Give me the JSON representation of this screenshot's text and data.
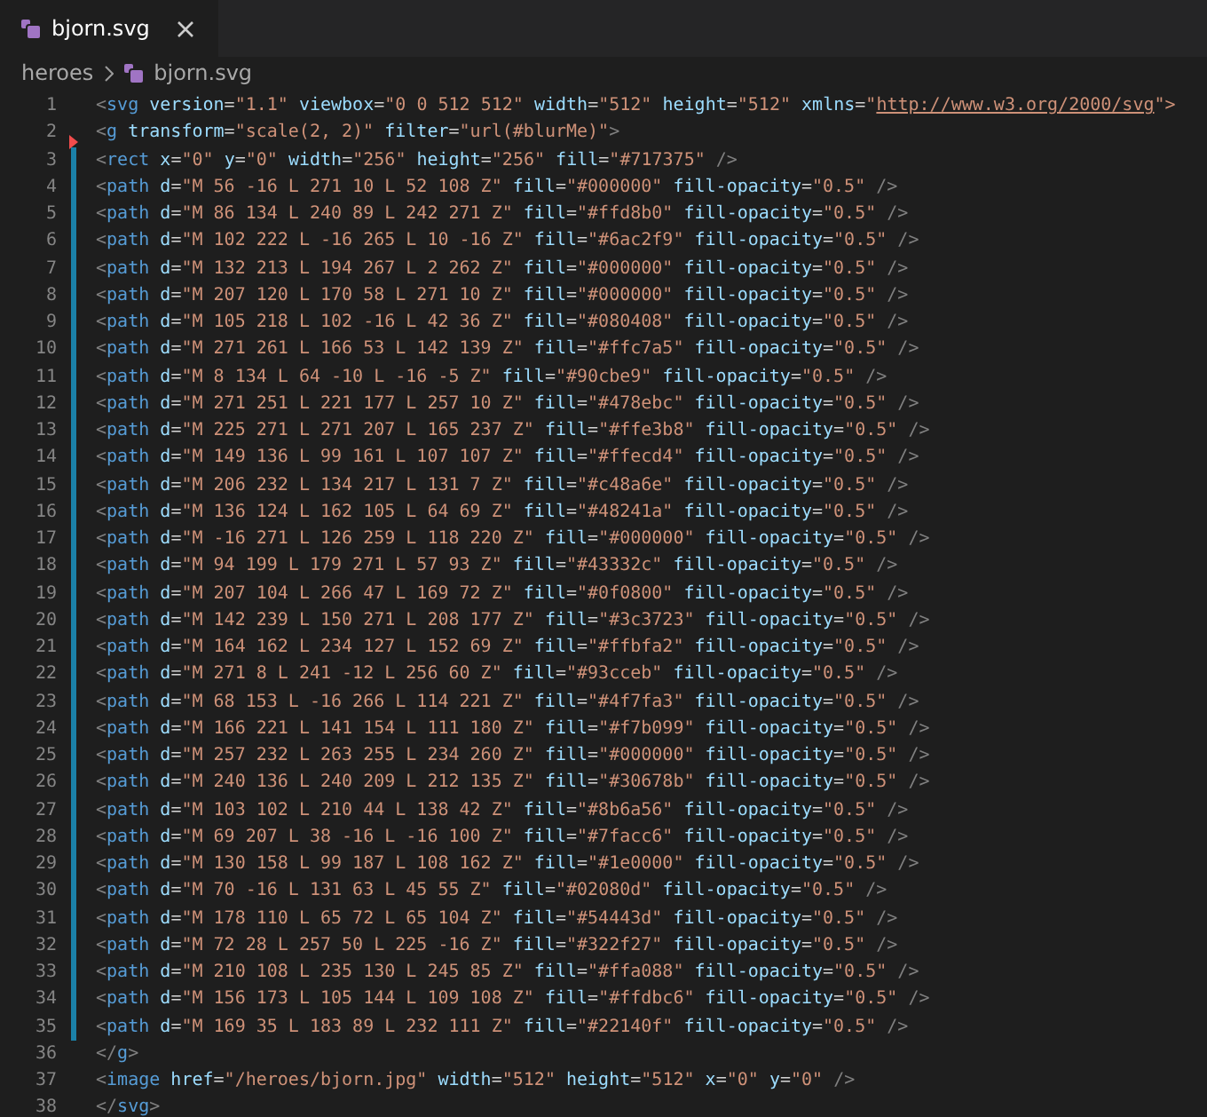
{
  "tab": {
    "title": "bjorn.svg",
    "selected": true
  },
  "breadcrumb": [
    {
      "label": "heroes",
      "kind": "folder"
    },
    {
      "label": "bjorn.svg",
      "kind": "file"
    }
  ],
  "lines": [
    {
      "number": "1",
      "modified": false,
      "deleted": false,
      "segments": [
        {
          "kind": "code",
          "text": "<svg version=\"1.1\" viewbox=\"0 0 512 512\" width=\"512\" height=\"512\" xmlns=\""
        },
        {
          "kind": "link",
          "text": "http://www.w3.org/2000/svg"
        },
        {
          "kind": "code",
          "text": "\">"
        }
      ]
    },
    {
      "number": "2",
      "modified": false,
      "deleted": true,
      "text": "<g transform=\"scale(2, 2)\" filter=\"url(#blurMe)\">"
    },
    {
      "number": "3",
      "modified": true,
      "deleted": false,
      "text": "<rect x=\"0\" y=\"0\" width=\"256\" height=\"256\" fill=\"#717375\" />"
    },
    {
      "number": "4",
      "modified": true,
      "deleted": false,
      "text": "<path d=\"M 56 -16 L 271 10 L 52 108 Z\" fill=\"#000000\" fill-opacity=\"0.5\" />"
    },
    {
      "number": "5",
      "modified": true,
      "deleted": false,
      "text": "<path d=\"M 86 134 L 240 89 L 242 271 Z\" fill=\"#ffd8b0\" fill-opacity=\"0.5\" />"
    },
    {
      "number": "6",
      "modified": true,
      "deleted": false,
      "text": "<path d=\"M 102 222 L -16 265 L 10 -16 Z\" fill=\"#6ac2f9\" fill-opacity=\"0.5\" />"
    },
    {
      "number": "7",
      "modified": true,
      "deleted": false,
      "text": "<path d=\"M 132 213 L 194 267 L 2 262 Z\" fill=\"#000000\" fill-opacity=\"0.5\" />"
    },
    {
      "number": "8",
      "modified": true,
      "deleted": false,
      "text": "<path d=\"M 207 120 L 170 58 L 271 10 Z\" fill=\"#000000\" fill-opacity=\"0.5\" />"
    },
    {
      "number": "9",
      "modified": true,
      "deleted": false,
      "text": "<path d=\"M 105 218 L 102 -16 L 42 36 Z\" fill=\"#080408\" fill-opacity=\"0.5\" />"
    },
    {
      "number": "10",
      "modified": true,
      "deleted": false,
      "text": "<path d=\"M 271 261 L 166 53 L 142 139 Z\" fill=\"#ffc7a5\" fill-opacity=\"0.5\" />"
    },
    {
      "number": "11",
      "modified": true,
      "deleted": false,
      "text": "<path d=\"M 8 134 L 64 -10 L -16 -5 Z\" fill=\"#90cbe9\" fill-opacity=\"0.5\" />"
    },
    {
      "number": "12",
      "modified": true,
      "deleted": false,
      "text": "<path d=\"M 271 251 L 221 177 L 257 10 Z\" fill=\"#478ebc\" fill-opacity=\"0.5\" />"
    },
    {
      "number": "13",
      "modified": true,
      "deleted": false,
      "text": "<path d=\"M 225 271 L 271 207 L 165 237 Z\" fill=\"#ffe3b8\" fill-opacity=\"0.5\" />"
    },
    {
      "number": "14",
      "modified": true,
      "deleted": false,
      "text": "<path d=\"M 149 136 L 99 161 L 107 107 Z\" fill=\"#ffecd4\" fill-opacity=\"0.5\" />"
    },
    {
      "number": "15",
      "modified": true,
      "deleted": false,
      "text": "<path d=\"M 206 232 L 134 217 L 131 7 Z\" fill=\"#c48a6e\" fill-opacity=\"0.5\" />"
    },
    {
      "number": "16",
      "modified": true,
      "deleted": false,
      "text": "<path d=\"M 136 124 L 162 105 L 64 69 Z\" fill=\"#48241a\" fill-opacity=\"0.5\" />"
    },
    {
      "number": "17",
      "modified": true,
      "deleted": false,
      "text": "<path d=\"M -16 271 L 126 259 L 118 220 Z\" fill=\"#000000\" fill-opacity=\"0.5\" />"
    },
    {
      "number": "18",
      "modified": true,
      "deleted": false,
      "text": "<path d=\"M 94 199 L 179 271 L 57 93 Z\" fill=\"#43332c\" fill-opacity=\"0.5\" />"
    },
    {
      "number": "19",
      "modified": true,
      "deleted": false,
      "text": "<path d=\"M 207 104 L 266 47 L 169 72 Z\" fill=\"#0f0800\" fill-opacity=\"0.5\" />"
    },
    {
      "number": "20",
      "modified": true,
      "deleted": false,
      "text": "<path d=\"M 142 239 L 150 271 L 208 177 Z\" fill=\"#3c3723\" fill-opacity=\"0.5\" />"
    },
    {
      "number": "21",
      "modified": true,
      "deleted": false,
      "text": "<path d=\"M 164 162 L 234 127 L 152 69 Z\" fill=\"#ffbfa2\" fill-opacity=\"0.5\" />"
    },
    {
      "number": "22",
      "modified": true,
      "deleted": false,
      "text": "<path d=\"M 271 8 L 241 -12 L 256 60 Z\" fill=\"#93cceb\" fill-opacity=\"0.5\" />"
    },
    {
      "number": "23",
      "modified": true,
      "deleted": false,
      "text": "<path d=\"M 68 153 L -16 266 L 114 221 Z\" fill=\"#4f7fa3\" fill-opacity=\"0.5\" />"
    },
    {
      "number": "24",
      "modified": true,
      "deleted": false,
      "text": "<path d=\"M 166 221 L 141 154 L 111 180 Z\" fill=\"#f7b099\" fill-opacity=\"0.5\" />"
    },
    {
      "number": "25",
      "modified": true,
      "deleted": false,
      "text": "<path d=\"M 257 232 L 263 255 L 234 260 Z\" fill=\"#000000\" fill-opacity=\"0.5\" />"
    },
    {
      "number": "26",
      "modified": true,
      "deleted": false,
      "text": "<path d=\"M 240 136 L 240 209 L 212 135 Z\" fill=\"#30678b\" fill-opacity=\"0.5\" />"
    },
    {
      "number": "27",
      "modified": true,
      "deleted": false,
      "text": "<path d=\"M 103 102 L 210 44 L 138 42 Z\" fill=\"#8b6a56\" fill-opacity=\"0.5\" />"
    },
    {
      "number": "28",
      "modified": true,
      "deleted": false,
      "text": "<path d=\"M 69 207 L 38 -16 L -16 100 Z\" fill=\"#7facc6\" fill-opacity=\"0.5\" />"
    },
    {
      "number": "29",
      "modified": true,
      "deleted": false,
      "text": "<path d=\"M 130 158 L 99 187 L 108 162 Z\" fill=\"#1e0000\" fill-opacity=\"0.5\" />"
    },
    {
      "number": "30",
      "modified": true,
      "deleted": false,
      "text": "<path d=\"M 70 -16 L 131 63 L 45 55 Z\" fill=\"#02080d\" fill-opacity=\"0.5\" />"
    },
    {
      "number": "31",
      "modified": true,
      "deleted": false,
      "text": "<path d=\"M 178 110 L 65 72 L 65 104 Z\" fill=\"#54443d\" fill-opacity=\"0.5\" />"
    },
    {
      "number": "32",
      "modified": true,
      "deleted": false,
      "text": "<path d=\"M 72 28 L 257 50 L 225 -16 Z\" fill=\"#322f27\" fill-opacity=\"0.5\" />"
    },
    {
      "number": "33",
      "modified": true,
      "deleted": false,
      "text": "<path d=\"M 210 108 L 235 130 L 245 85 Z\" fill=\"#ffa088\" fill-opacity=\"0.5\" />"
    },
    {
      "number": "34",
      "modified": true,
      "deleted": false,
      "text": "<path d=\"M 156 173 L 105 144 L 109 108 Z\" fill=\"#ffdbc6\" fill-opacity=\"0.5\" />"
    },
    {
      "number": "35",
      "modified": true,
      "deleted": false,
      "text": "<path d=\"M 169 35 L 183 89 L 232 111 Z\" fill=\"#22140f\" fill-opacity=\"0.5\" />"
    },
    {
      "number": "36",
      "modified": false,
      "deleted": false,
      "text": "</g>"
    },
    {
      "number": "37",
      "modified": false,
      "deleted": false,
      "text": "<image href=\"/heroes/bjorn.jpg\" width=\"512\" height=\"512\" x=\"0\" y=\"0\" />"
    },
    {
      "number": "38",
      "modified": false,
      "deleted": false,
      "text": "</svg>"
    }
  ]
}
